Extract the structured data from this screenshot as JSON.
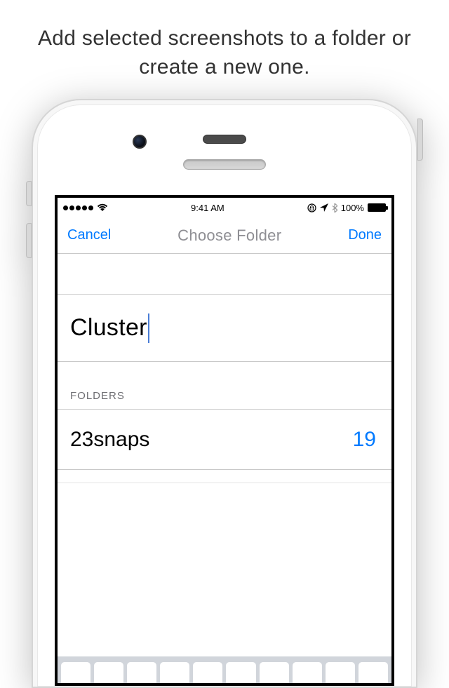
{
  "marketing": {
    "headline": "Add selected screenshots to a folder or create a new one."
  },
  "status_bar": {
    "time": "9:41 AM",
    "battery_percent": "100%"
  },
  "nav": {
    "cancel": "Cancel",
    "title": "Choose Folder",
    "done": "Done"
  },
  "input": {
    "value": "Cluster"
  },
  "section": {
    "folders_label": "FOLDERS"
  },
  "folders": [
    {
      "name": "23snaps",
      "count": "19"
    }
  ]
}
